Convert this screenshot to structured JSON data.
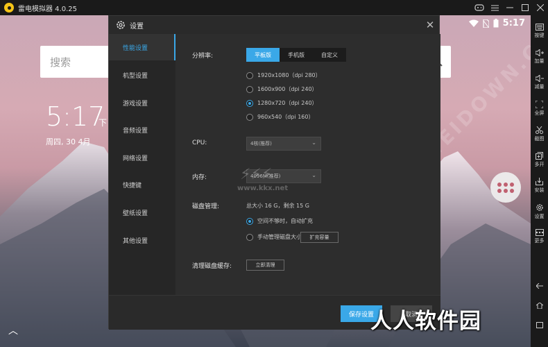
{
  "app": {
    "title": "雷电模拟器 4.0.25"
  },
  "android": {
    "time_status": "5:17",
    "search_placeholder": "搜索",
    "clock": "5:17",
    "clock_suffix": "下",
    "date": "周四, 30 4月"
  },
  "sidebar": {
    "items": [
      {
        "label": "按键",
        "icon": "keyboard-icon"
      },
      {
        "label": "加量",
        "icon": "volume-up-icon"
      },
      {
        "label": "减量",
        "icon": "volume-down-icon"
      },
      {
        "label": "全屏",
        "icon": "fullscreen-icon"
      },
      {
        "label": "截图",
        "icon": "scissors-icon"
      },
      {
        "label": "多开",
        "icon": "multi-instance-icon"
      },
      {
        "label": "安装",
        "icon": "install-icon"
      },
      {
        "label": "设置",
        "icon": "gear-icon"
      },
      {
        "label": "更多",
        "icon": "more-icon"
      }
    ]
  },
  "dialog": {
    "title": "设置",
    "nav": [
      "性能设置",
      "机型设置",
      "游戏设置",
      "音频设置",
      "网络设置",
      "快捷键",
      "壁纸设置",
      "其他设置"
    ],
    "active_nav": "性能设置",
    "resolution": {
      "label": "分辨率:",
      "tabs": [
        "平板版",
        "手机版",
        "自定义"
      ],
      "active_tab": "平板版",
      "options": [
        "1920x1080（dpi 280）",
        "1600x900（dpi 240）",
        "1280x720（dpi 240）",
        "960x540（dpi 160）"
      ],
      "selected": "1280x720（dpi 240）"
    },
    "cpu": {
      "label": "CPU:",
      "value": "4核(推荐)"
    },
    "memory": {
      "label": "内存:",
      "value": "4096M(推荐)"
    },
    "disk": {
      "label": "磁盘管理:",
      "info": "总大小 16 G，剩余 15 G",
      "option_auto": "空间不够时，自动扩充",
      "option_manual": "手动管理磁盘大小",
      "expand_button": "扩充容量"
    },
    "cache": {
      "label": "清理磁盘缓存:",
      "button": "立即清理"
    },
    "save_button": "保存设置",
    "cancel_button": "取消"
  },
  "watermarks": {
    "site": "WWW.WEIDOWN.COM",
    "kkx": "www.kkx.net",
    "brand": "人人软件园"
  },
  "colors": {
    "accent": "#3aa8e8",
    "dialog_bg": "#2d2d2d",
    "nav_bg": "#262626"
  }
}
